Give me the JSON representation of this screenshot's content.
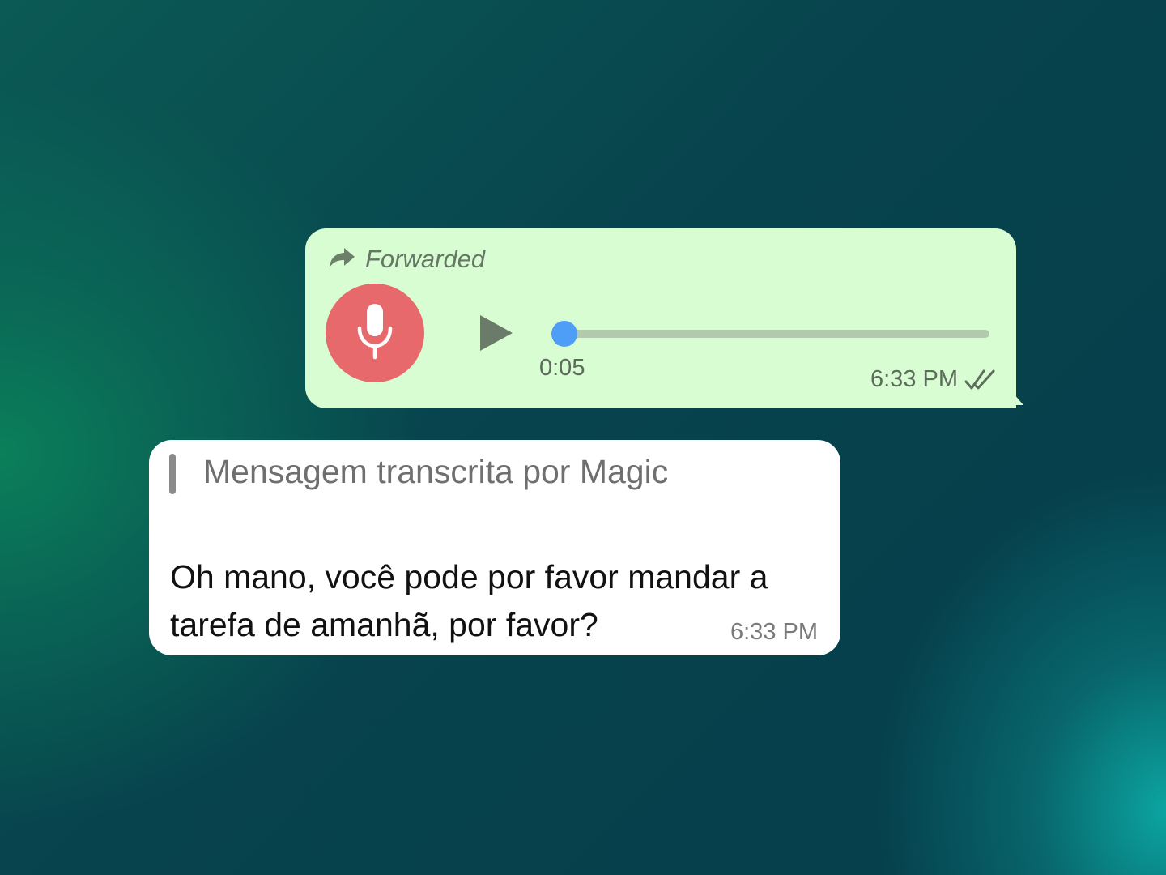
{
  "voice_message": {
    "forwarded_label": "Forwarded",
    "duration": "0:05",
    "timestamp": "6:33 PM",
    "playback_progress": 0.03,
    "status": "read",
    "icons": {
      "forward": "forward-arrow-icon",
      "mic": "microphone-icon",
      "play": "play-icon",
      "ticks": "double-check-icon"
    },
    "colors": {
      "bubble": "#d9fdd3",
      "mic_circle": "#e8696b",
      "progress_knob": "#4e9ef7",
      "track": "#b3c9ae"
    }
  },
  "transcription": {
    "quote_header": "Mensagem transcrita por Magic",
    "message_line1": "Oh mano, você pode por favor mandar a",
    "message_line2": "tarefa de amanhã, por favor?",
    "timestamp": "6:33 PM",
    "colors": {
      "bubble": "#ffffff",
      "quote_bar": "#8a8a8a"
    }
  }
}
